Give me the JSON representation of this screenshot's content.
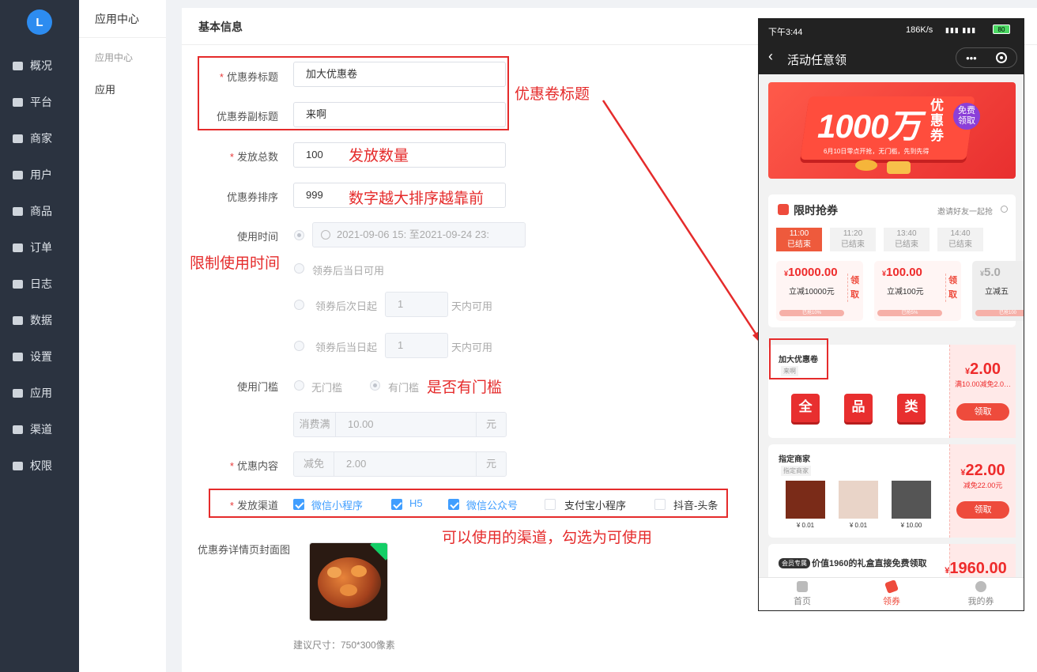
{
  "sidebar": {
    "logo": "L",
    "items": [
      {
        "label": "概况",
        "icon": "chart-icon"
      },
      {
        "label": "平台",
        "icon": "monitor-icon"
      },
      {
        "label": "商家",
        "icon": "shop-icon"
      },
      {
        "label": "用户",
        "icon": "user-icon"
      },
      {
        "label": "商品",
        "icon": "goods-icon"
      },
      {
        "label": "订单",
        "icon": "order-icon"
      },
      {
        "label": "日志",
        "icon": "log-icon"
      },
      {
        "label": "数据",
        "icon": "data-icon"
      },
      {
        "label": "设置",
        "icon": "gear-icon"
      },
      {
        "label": "应用",
        "icon": "apps-icon"
      },
      {
        "label": "渠道",
        "icon": "channel-icon"
      },
      {
        "label": "权限",
        "icon": "lock-icon"
      }
    ]
  },
  "subnav": {
    "title": "应用中心",
    "group": "应用中心",
    "item": "应用"
  },
  "form": {
    "section_title": "基本信息",
    "title_label": "优惠券标题",
    "title_value": "加大优惠卷",
    "subtitle_label": "优惠券副标题",
    "subtitle_value": "来啊",
    "total_label": "发放总数",
    "total_value": "100",
    "sort_label": "优惠券排序",
    "sort_value": "999",
    "time_label": "使用时间",
    "time_range": "2021-09-06 15: 至2021-09-24 23:",
    "opt_same_day": "领券后当日可用",
    "opt_next_day_pre": "领券后次日起",
    "opt_next_day_value": "1",
    "opt_next_day_post": "天内可用",
    "opt_same_day2_pre": "领券后当日起",
    "opt_same_day2_value": "1",
    "opt_same_day2_post": "天内可用",
    "threshold_label": "使用门槛",
    "no_threshold": "无门槛",
    "has_threshold": "有门槛",
    "min_prefix": "消费满",
    "min_value": "10.00",
    "unit": "元",
    "content_label": "优惠内容",
    "discount_prefix": "减免",
    "discount_value": "2.00",
    "channel_label": "发放渠道",
    "channels": [
      {
        "label": "微信小程序",
        "checked": true
      },
      {
        "label": "H5",
        "checked": true
      },
      {
        "label": "微信公众号",
        "checked": true
      },
      {
        "label": "支付宝小程序",
        "checked": false
      },
      {
        "label": "抖音-头条",
        "checked": false
      }
    ],
    "cover_label": "优惠券详情页封面图",
    "cover_hint": "建议尺寸：750*300像素"
  },
  "annotations": {
    "title": "优惠卷标题",
    "quantity": "发放数量",
    "sort": "数字越大排序越靠前",
    "time": "限制使用时间",
    "threshold": "是否有门槛",
    "channel": "可以使用的渠道，勾选为可使用"
  },
  "phone": {
    "time": "下午3:44",
    "net": "186K/s",
    "battery": "80",
    "nav_title": "活动任意领",
    "banner_big": "1000万",
    "banner_side": "优惠券",
    "banner_badge": "免费领取",
    "banner_sub": "6月10日零点开抢，无门槛，先到先得",
    "flash_title": "限时抢券",
    "invite": "邀请好友一起抢",
    "slots": [
      {
        "time": "11:00",
        "state": "已结束"
      },
      {
        "time": "11:20",
        "state": "已结束"
      },
      {
        "time": "13:40",
        "state": "已结束"
      },
      {
        "time": "14:40",
        "state": "已结束"
      }
    ],
    "currency": "¥",
    "get": "领取",
    "get_v": "领\n取",
    "minis": [
      {
        "amount": "10000.00",
        "desc": "立减10000元",
        "bar": "已抢10%"
      },
      {
        "amount": "100.00",
        "desc": "立减100元",
        "bar": "已抢5%"
      },
      {
        "amount": "5.0",
        "desc": "立减五",
        "bar": "已抢100"
      }
    ],
    "coupon1": {
      "title": "加大优惠卷",
      "tag": "来啊",
      "icons": [
        "全",
        "品",
        "类"
      ],
      "amount": "2.00",
      "desc": "满10.00减免2.0…"
    },
    "coupon2": {
      "title": "指定商家",
      "tag": "指定商家",
      "prices": [
        "¥ 0.01",
        "¥ 0.01",
        "¥ 10.00"
      ],
      "amount": "22.00",
      "desc": "减免22.00元"
    },
    "coupon3": {
      "badge": "会员专属",
      "title": "价值1960的礼盒直接免费领取",
      "amount": "1960.00"
    },
    "tabs": [
      "首页",
      "领券",
      "我的券"
    ]
  }
}
